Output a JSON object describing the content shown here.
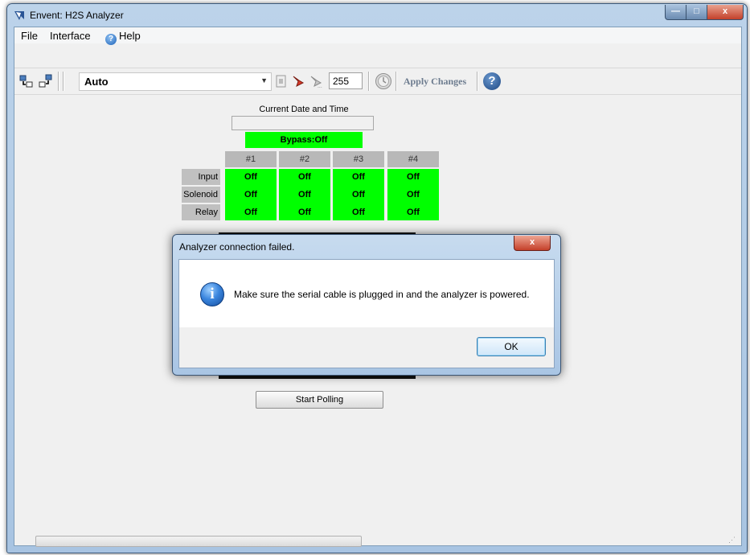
{
  "window": {
    "title": "Envent: H2S Analyzer",
    "controls": {
      "minimize": "—",
      "maximize": "□",
      "close": "x"
    }
  },
  "menu": {
    "items": [
      "File",
      "Interface",
      "Help"
    ]
  },
  "toolbar": {
    "mode_value": "Auto",
    "numeric_value": "255",
    "apply_label": "Apply Changes",
    "help_label": "?"
  },
  "panel": {
    "datetime_label": "Current Date and Time",
    "datetime_value": "",
    "bypass": "Bypass:Off",
    "columns": [
      "#1",
      "#2",
      "#3",
      "#4"
    ],
    "rows": [
      {
        "label": "Input",
        "values": [
          "Off",
          "Off",
          "Off",
          "Off"
        ]
      },
      {
        "label": "Solenoid",
        "values": [
          "Off",
          "Off",
          "Off",
          "Off"
        ]
      },
      {
        "label": "Relay",
        "values": [
          "Off",
          "Off",
          "Off",
          "Off"
        ]
      }
    ],
    "start_polling": "Start Polling"
  },
  "dialog": {
    "title": "Analyzer connection failed.",
    "message": "Make sure the serial cable is plugged in and the analyzer is powered.",
    "ok_label": "OK",
    "close_label": "x",
    "icon": "info-icon"
  },
  "colors": {
    "status_on_bg": "#00ff00",
    "header_gray": "#b8b8b8"
  }
}
